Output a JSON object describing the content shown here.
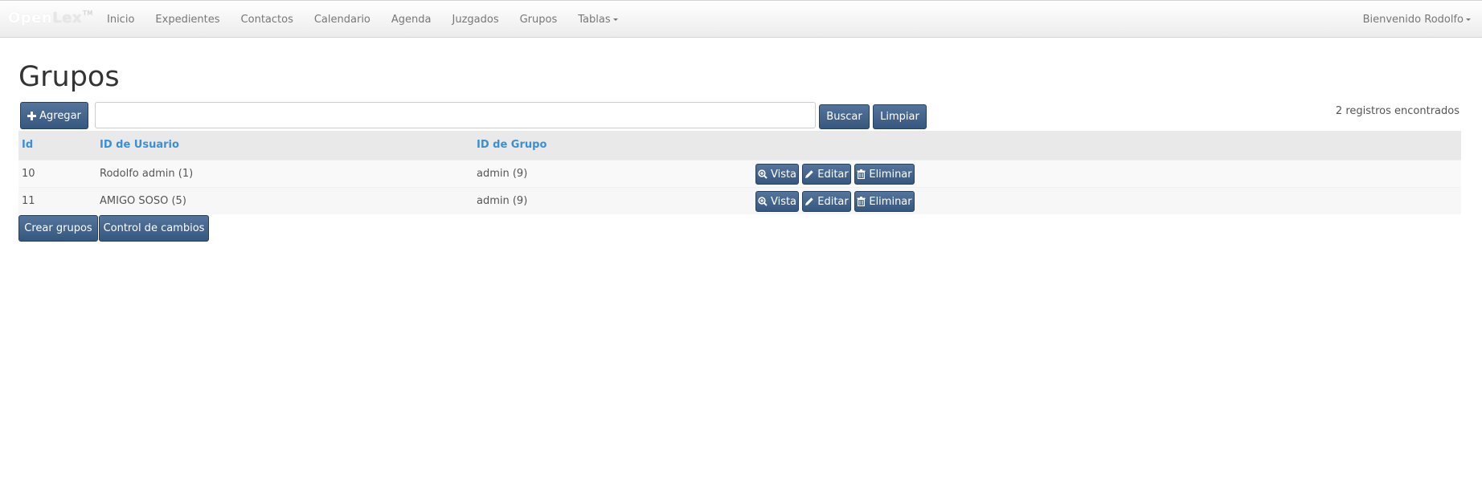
{
  "navbar": {
    "brand_open": "Open",
    "brand_lex": "Lex",
    "brand_tm": "TM",
    "items": [
      {
        "label": "Inicio"
      },
      {
        "label": "Expedientes"
      },
      {
        "label": "Contactos"
      },
      {
        "label": "Calendario"
      },
      {
        "label": "Agenda"
      },
      {
        "label": "Juzgados"
      },
      {
        "label": "Grupos"
      },
      {
        "label": "Tablas"
      }
    ],
    "user_menu": "Bienvenido Rodolfo"
  },
  "page": {
    "title": "Grupos"
  },
  "toolbar": {
    "add_label": "Agregar",
    "search_value": "",
    "search_label": "Buscar",
    "clear_label": "Limpiar",
    "count_text": "2 registros encontrados"
  },
  "table": {
    "headers": [
      "Id",
      "ID de Usuario",
      "ID de Grupo"
    ],
    "rows": [
      {
        "id": "10",
        "usuario": "Rodolfo admin (1)",
        "grupo": "admin (9)"
      },
      {
        "id": "11",
        "usuario": "AMIGO SOSO (5)",
        "grupo": "admin (9)"
      }
    ],
    "actions": {
      "view": "Vista",
      "edit": "Editar",
      "delete": "Eliminar"
    }
  },
  "footer_buttons": {
    "create": "Crear grupos",
    "changes": "Control de cambios"
  },
  "colors": {
    "button": "#3f6089",
    "link": "#3a8fd6",
    "navbar": "#f2f2f2"
  }
}
